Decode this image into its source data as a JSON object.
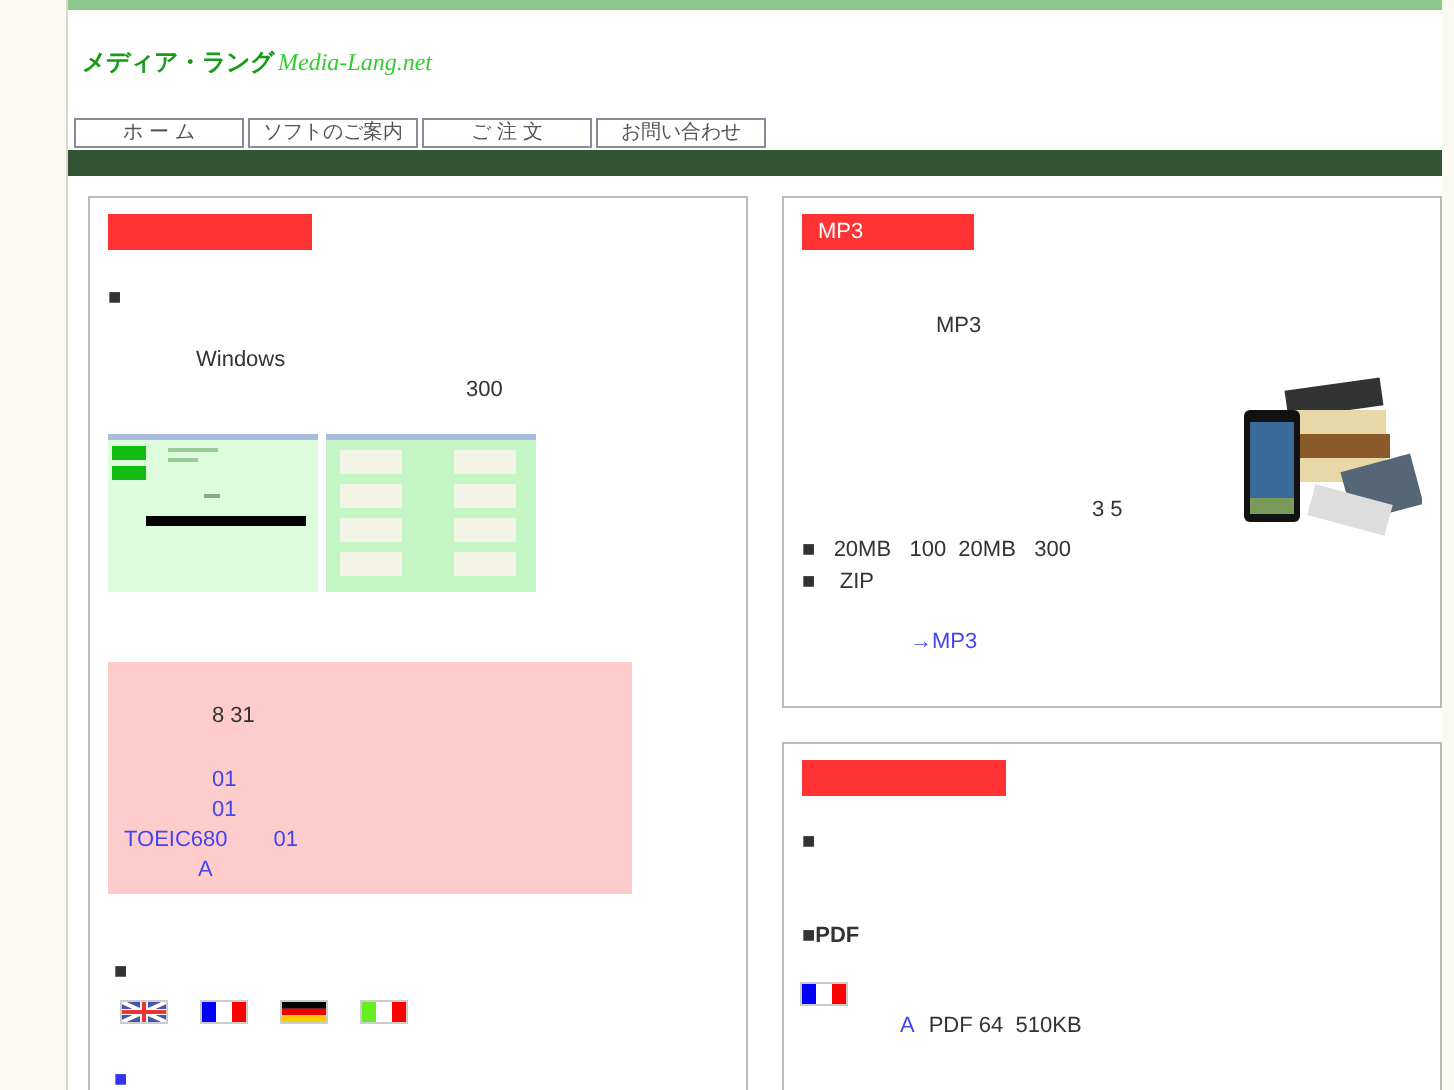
{
  "header": {
    "logo_jp": "メディア・ラング",
    "logo_en": "Media-Lang.net"
  },
  "nav": [
    {
      "label": "ホ ー ム"
    },
    {
      "label": "ソフトのご案内"
    },
    {
      "label": "ご 注 文"
    },
    {
      "label": "お問い合わせ"
    }
  ],
  "left_panel": {
    "bullet": "■",
    "line_1": "Windows",
    "line_2": "300",
    "notice": {
      "date": "8 31",
      "items": [
        "01",
        "01"
      ],
      "toeic": "TOEIC680",
      "toeic_no": "01",
      "grade": "A"
    },
    "languages_bullet": "■",
    "flags": [
      {
        "kind": "uk"
      },
      {
        "kind": "fr"
      },
      {
        "kind": "de"
      },
      {
        "kind": "it"
      }
    ],
    "blue_bullet": "■"
  },
  "mp3_panel": {
    "title": "MP3",
    "intro": "MP3",
    "duration": "3 5",
    "specs": [
      "■   20MB   100  20MB   300",
      "■    ZIP"
    ],
    "link": "→MP3"
  },
  "pdf_panel": {
    "bullet": "■",
    "pdf_heading": "■PDF",
    "flag": {
      "kind": "fr"
    },
    "grade": "A",
    "file_info": "PDF 64  510KB"
  }
}
